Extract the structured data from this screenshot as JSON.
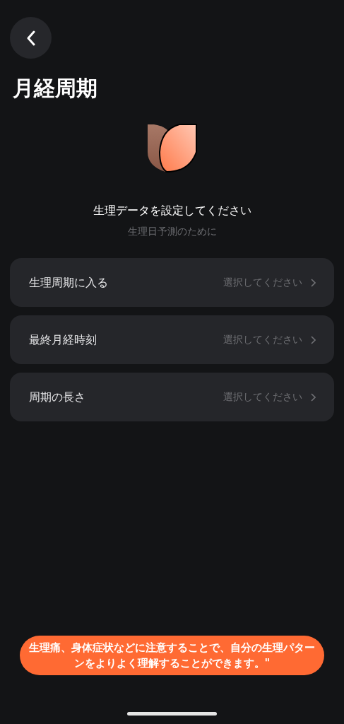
{
  "header": {
    "title": "月経周期"
  },
  "intro": {
    "heading": "生理データを設定してください",
    "subtitle": "生理日予測のために"
  },
  "rows": [
    {
      "label": "生理周期に入る",
      "value": "選択してください"
    },
    {
      "label": "最終月経時刻",
      "value": "選択してください"
    },
    {
      "label": "周期の長さ",
      "value": "選択してください"
    }
  ],
  "toast": {
    "text": "生理痛、身体症状などに注意することで、自分の生理パターンをよりよく理解することができます。\""
  }
}
